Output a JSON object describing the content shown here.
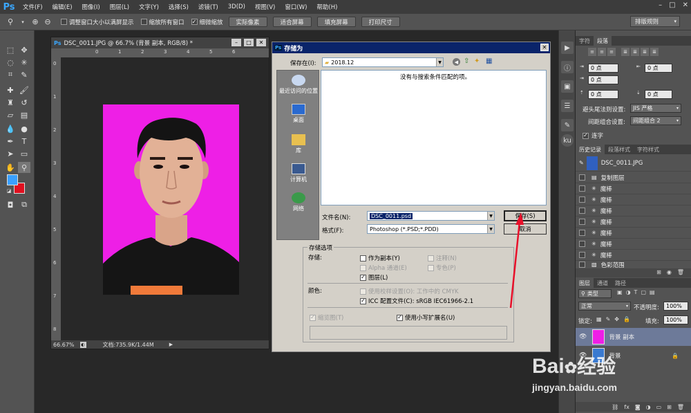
{
  "app": {
    "logo": "Ps"
  },
  "menu": [
    "文件(F)",
    "编辑(E)",
    "图像(I)",
    "图层(L)",
    "文字(Y)",
    "选择(S)",
    "滤镜(T)",
    "3D(D)",
    "视图(V)",
    "窗口(W)",
    "帮助(H)"
  ],
  "optbar": {
    "check1": "调整窗口大小以满屏显示",
    "check2": "缩放所有窗口",
    "check3": "细微缩放",
    "btn_actual": "实际像素",
    "btn_fit": "适合屏幕",
    "btn_fill": "填充屏幕",
    "btn_print": "打印尺寸",
    "workspace": "排版规则"
  },
  "document": {
    "title": "DSC_0011.JPG @ 66.7% (背景 副本, RGB/8) *",
    "zoom": "66.67%",
    "doc_size": "文档:735.9K/1.44M",
    "ruler_top": [
      "0",
      "1",
      "2",
      "3",
      "4",
      "5",
      "6"
    ],
    "ruler_left": [
      "0",
      "1",
      "2",
      "3",
      "4",
      "5",
      "6",
      "7",
      "8"
    ]
  },
  "dialog": {
    "title": "存储为",
    "save_in_label": "保存在(I):",
    "save_in_value": "2018.12",
    "no_match": "没有与搜索条件匹配的项。",
    "places": [
      "最近访问的位置",
      "桌面",
      "库",
      "计算机",
      "网络"
    ],
    "filename_label": "文件名(N):",
    "filename_value": "DSC_0011.psd",
    "format_label": "格式(F):",
    "format_value": "Photoshop (*.PSD;*.PDD)",
    "save_btn": "保存(S)",
    "cancel_btn": "取消",
    "options_title": "存储选项",
    "storage_label": "存储:",
    "as_copy": "作为副本(Y)",
    "notes": "注释(N)",
    "alpha": "Alpha 通道(E)",
    "spot": "专色(P)",
    "layers": "图层(L)",
    "color_label": "颜色:",
    "proof": "使用校样设置(O):   工作中的 CMYK",
    "icc": "ICC 配置文件(C):  sRGB IEC61966-2.1",
    "thumbnail": "缩览图(T)",
    "lowercase": "使用小写扩展名(U)"
  },
  "char_panel": {
    "tab1": "字符",
    "tab2": "段落",
    "val_pt": "0 点",
    "hanging_label": "避头尾法则设置:",
    "hanging_value": "JIS 严格",
    "spacing_label": "间距组合设置:",
    "spacing_value": "间距组合 2",
    "hyphen": "连字"
  },
  "history_panel": {
    "tab1": "历史记录",
    "tab2": "段落样式",
    "tab3": "字符样式",
    "snapshot": "DSC_0011.JPG",
    "items": [
      "复制图层",
      "魔棒",
      "魔棒",
      "魔棒",
      "魔棒",
      "魔棒",
      "魔棒",
      "魔棒",
      "色彩范围"
    ]
  },
  "layers_panel": {
    "tab1": "图层",
    "tab2": "通道",
    "tab3": "路径",
    "kind": "类型",
    "blend": "正常",
    "opacity_label": "不透明度:",
    "opacity_value": "100%",
    "lock_label": "锁定:",
    "fill_label": "填充:",
    "fill_value": "100%",
    "layer1": "背景 副本",
    "layer2": "背景"
  },
  "watermark": {
    "brand_a": "Bai",
    "brand_b": "经验",
    "url": "jingyan.baidu.com"
  },
  "colors": {
    "photo_bg": "#ee1fe6",
    "dialog_title": "#0a246a",
    "fg_swatch": "#3aa0ff",
    "bg_swatch": "#e01020",
    "arrow": "#e8102a"
  }
}
